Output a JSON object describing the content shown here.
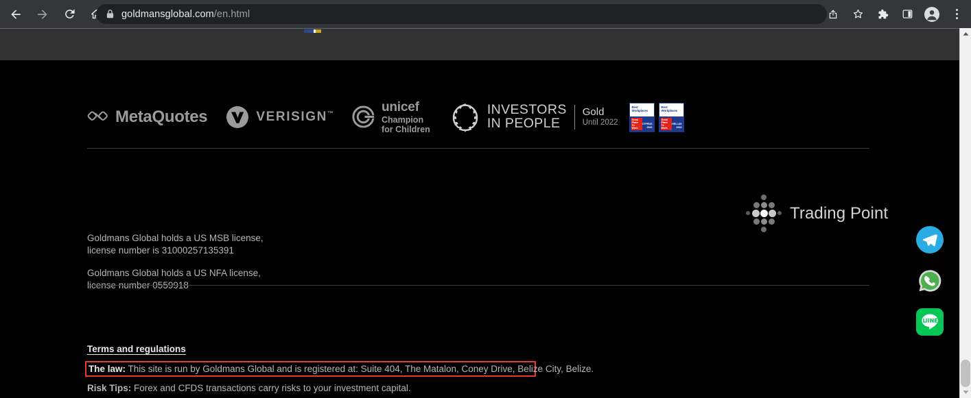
{
  "browser": {
    "back_label": "Back",
    "forward_label": "Forward",
    "reload_label": "Reload",
    "home_label": "Home",
    "url_domain": "goldmansglobal.com",
    "url_path": "/en.html",
    "share_label": "Share this page",
    "bookmark_label": "Bookmark this tab",
    "extensions_label": "Extensions",
    "sidepanel_label": "Side panel",
    "profile_label": "Profile",
    "menu_label": "Customize and control Google Chrome",
    "icons": {
      "back": "back-arrow-icon",
      "forward": "forward-arrow-icon",
      "reload": "reload-icon",
      "home": "home-icon",
      "lock": "lock-icon",
      "share": "share-icon",
      "bookmark": "star-icon",
      "extensions": "puzzle-piece-icon",
      "sidepanel": "side-panel-icon",
      "profile": "avatar-icon",
      "menu": "three-dot-menu-icon"
    }
  },
  "partners": {
    "metaquotes": {
      "name": "MetaQuotes",
      "icon": "metaquotes-logo-icon"
    },
    "verisign": {
      "name": "VERISIGN",
      "trademark": "™",
      "icon": "verisign-logo-icon"
    },
    "unicef": {
      "name": "unicef",
      "line1": "Champion",
      "line2": "for Children",
      "icon": "unicef-logo-icon"
    },
    "investors": {
      "line1": "INVESTORS",
      "line2": "IN PEOPLE",
      "award": "Gold",
      "award_sub": "Until 2022",
      "icon": "investors-in-people-wreath-icon"
    },
    "best_workplaces": [
      {
        "title_line1": "Best",
        "title_line2": "Workplaces",
        "gptw_l1": "Great",
        "gptw_l2": "Place",
        "gptw_l3": "To",
        "gptw_l4": "Work.",
        "region": "CYPRUS",
        "year": "2022"
      },
      {
        "title_line1": "Best",
        "title_line2": "Workplaces",
        "gptw_l1": "Great",
        "gptw_l2": "Place",
        "gptw_l3": "To",
        "gptw_l4": "Work.",
        "region": "HELLAS",
        "year": "2022"
      }
    ]
  },
  "trading_point": {
    "name": "Trading Point",
    "icon": "trading-point-dots-logo-icon"
  },
  "licenses": [
    "Goldmans Global holds a US MSB license, license number is 31000257135391",
    "Goldmans Global holds a US NFA license, license number 0559918"
  ],
  "license_lines": {
    "msb_line1": "Goldmans Global holds a US MSB license,",
    "msb_line2": "license number is 31000257135391",
    "nfa_line1": "Goldmans Global holds a US NFA license,",
    "nfa_line2": "license number 0559918"
  },
  "terms": {
    "heading": "Terms and regulations",
    "law_label": "The law:",
    "law_text": " This site is run by Goldmans Global and is registered at: Suite 404, The Matalon, Coney Drive, Belize City, Belize.",
    "risk_label": "Risk Tips:",
    "risk_text": " Forex and CFDS transactions carry risks to your investment capital."
  },
  "social": [
    {
      "name": "Telegram",
      "icon": "telegram-icon",
      "color": "#2AABE2"
    },
    {
      "name": "WhatsApp",
      "icon": "whatsapp-icon",
      "color": "#4CAF50"
    },
    {
      "name": "LINE",
      "icon": "line-icon",
      "label": "LINE",
      "color": "#06C755"
    }
  ],
  "colors": {
    "page_background": "#000000",
    "chrome_toolbar": "#35363A",
    "omnibox": "#202124",
    "highlight_red": "#E8392B",
    "body_text": "#B6B6B6",
    "divider": "#3D3D3D"
  },
  "scrollbar": {
    "position": "bottom",
    "up_arrow": "scroll-up-arrow-icon",
    "down_arrow": "scroll-down-arrow-icon"
  }
}
